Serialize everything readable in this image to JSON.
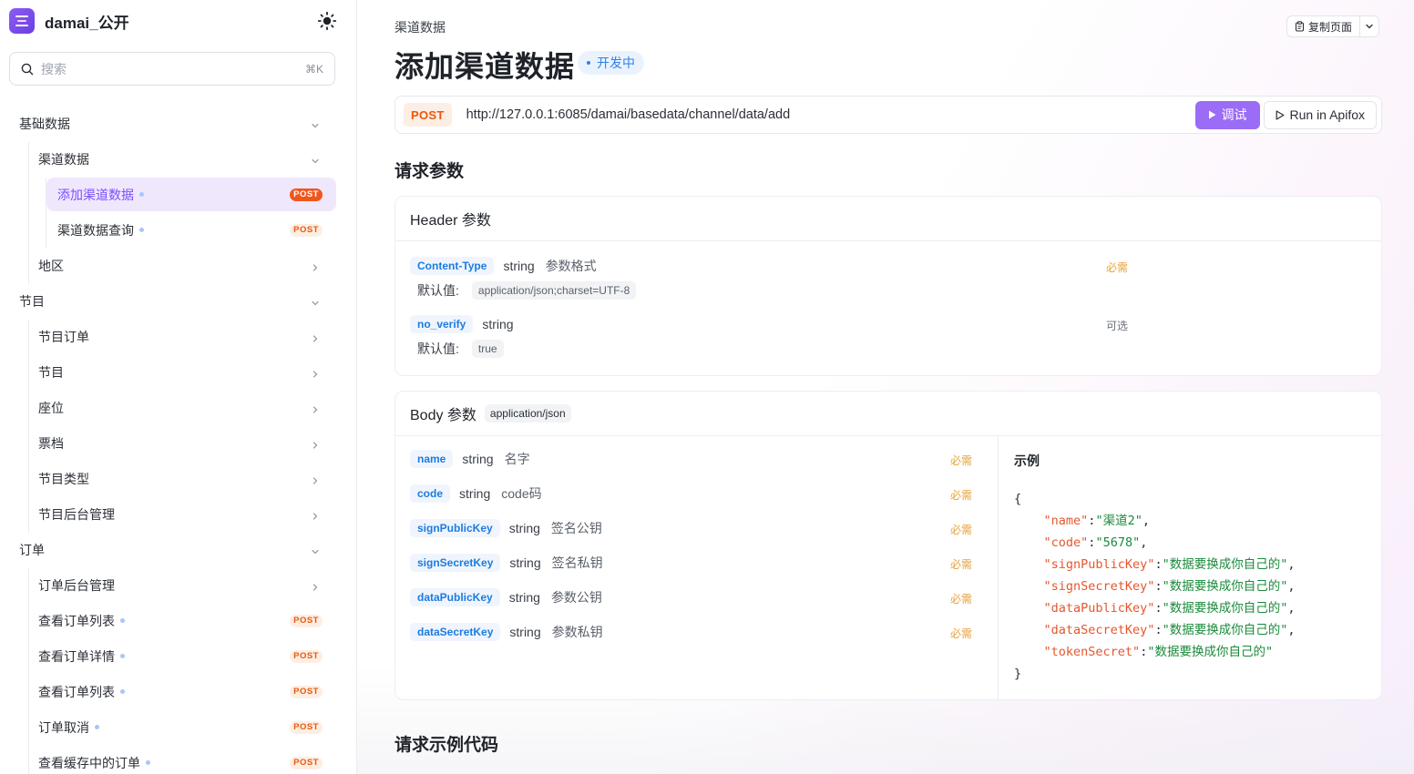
{
  "app": {
    "name": "damai_公开"
  },
  "search": {
    "placeholder": "搜索",
    "shortcut": "⌘K"
  },
  "nav": {
    "items": [
      {
        "label": "基础数据",
        "level": 0,
        "expanded": true
      },
      {
        "label": "渠道数据",
        "level": 1,
        "expanded": true
      },
      {
        "label": "添加渠道数据",
        "level": 2,
        "method": "POST",
        "active": true
      },
      {
        "label": "渠道数据查询",
        "level": 2,
        "method": "POST"
      },
      {
        "label": "地区",
        "level": 1
      },
      {
        "label": "节目",
        "level": 0,
        "expanded": true
      },
      {
        "label": "节目订单",
        "level": 1
      },
      {
        "label": "节目",
        "level": 1
      },
      {
        "label": "座位",
        "level": 1
      },
      {
        "label": "票档",
        "level": 1
      },
      {
        "label": "节目类型",
        "level": 1
      },
      {
        "label": "节目后台管理",
        "level": 1
      },
      {
        "label": "订单",
        "level": 0,
        "expanded": true
      },
      {
        "label": "订单后台管理",
        "level": 1
      },
      {
        "label": "查看订单列表",
        "level": 1,
        "method": "POST"
      },
      {
        "label": "查看订单详情",
        "level": 1,
        "method": "POST"
      },
      {
        "label": "查看订单列表",
        "level": 1,
        "method": "POST"
      },
      {
        "label": "订单取消",
        "level": 1,
        "method": "POST"
      },
      {
        "label": "查看缓存中的订单",
        "level": 1,
        "method": "POST"
      }
    ]
  },
  "header": {
    "breadcrumb": "渠道数据",
    "copy_label": "复制页面"
  },
  "page": {
    "title": "添加渠道数据",
    "status": "开发中"
  },
  "request": {
    "method": "POST",
    "url": "http://127.0.0.1:6085/damai/basedata/channel/data/add",
    "debug_label": "调试",
    "apifox_label": "Run in Apifox"
  },
  "sections": {
    "params_title": "请求参数",
    "code_title": "请求示例代码"
  },
  "header_params": {
    "title": "Header 参数",
    "default_label": "默认值:",
    "items": [
      {
        "name": "Content-Type",
        "type": "string",
        "desc": "参数格式",
        "required": "必需",
        "default": "application/json;charset=UTF-8"
      },
      {
        "name": "no_verify",
        "type": "string",
        "desc": "",
        "required": "可选",
        "default": "true"
      }
    ]
  },
  "body_params": {
    "title": "Body 参数",
    "content_type": "application/json",
    "example_label": "示例",
    "items": [
      {
        "name": "name",
        "type": "string",
        "desc": "名字",
        "required": "必需"
      },
      {
        "name": "code",
        "type": "string",
        "desc": "code码",
        "required": "必需"
      },
      {
        "name": "signPublicKey",
        "type": "string",
        "desc": "签名公钥",
        "required": "必需"
      },
      {
        "name": "signSecretKey",
        "type": "string",
        "desc": "签名私钥",
        "required": "必需"
      },
      {
        "name": "dataPublicKey",
        "type": "string",
        "desc": "参数公钥",
        "required": "必需"
      },
      {
        "name": "dataSecretKey",
        "type": "string",
        "desc": "参数私钥",
        "required": "必需"
      }
    ],
    "example": {
      "open": "{",
      "close": "}",
      "lines": [
        {
          "key": "\"name\"",
          "value": "\"渠道2\"",
          "comma": ","
        },
        {
          "key": "\"code\"",
          "value": "\"5678\"",
          "comma": ","
        },
        {
          "key": "\"signPublicKey\"",
          "value": "\"数据要换成你自己的\"",
          "comma": ","
        },
        {
          "key": "\"signSecretKey\"",
          "value": "\"数据要换成你自己的\"",
          "comma": ","
        },
        {
          "key": "\"dataPublicKey\"",
          "value": "\"数据要换成你自己的\"",
          "comma": ","
        },
        {
          "key": "\"dataSecretKey\"",
          "value": "\"数据要换成你自己的\"",
          "comma": ","
        },
        {
          "key": "\"tokenSecret\"",
          "value": "\"数据要换成你自己的\"",
          "comma": ""
        }
      ]
    }
  },
  "colors": {
    "accent": "#9b6cf6",
    "post": "#ea580c",
    "link": "#1c7ce0",
    "required": "#e6a23c",
    "code_key": "#e4572e",
    "code_value": "#1a8a3a"
  }
}
